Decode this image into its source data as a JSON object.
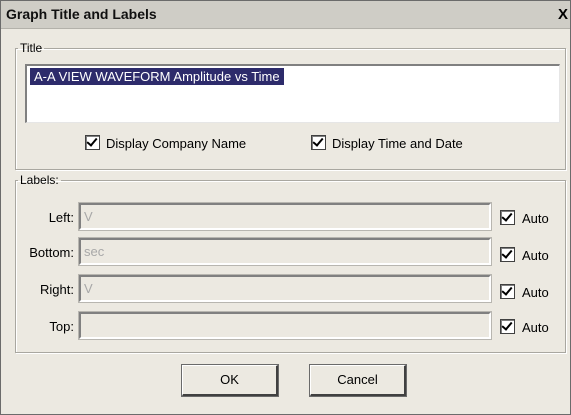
{
  "window": {
    "title": "Graph Title and Labels",
    "close_glyph": "X"
  },
  "title_group": {
    "legend": "Title",
    "value": "A-A VIEW WAVEFORM  Amplitude vs Time",
    "display_company_name": {
      "label": "Display Company Name",
      "checked": true
    },
    "display_time_date": {
      "label": "Display Time and Date",
      "checked": true
    }
  },
  "labels_group": {
    "legend": "Labels:",
    "rows": [
      {
        "label": "Left:",
        "value": "V",
        "auto_label": "Auto",
        "auto_checked": true
      },
      {
        "label": "Bottom:",
        "value": "sec",
        "auto_label": "Auto",
        "auto_checked": true
      },
      {
        "label": "Right:",
        "value": "V",
        "auto_label": "Auto",
        "auto_checked": true
      },
      {
        "label": "Top:",
        "value": "",
        "auto_label": "Auto",
        "auto_checked": true
      }
    ]
  },
  "buttons": {
    "ok": "OK",
    "cancel": "Cancel"
  },
  "colors": {
    "selection": "#2d2b6b",
    "dialog_bg": "#ece9e1"
  }
}
